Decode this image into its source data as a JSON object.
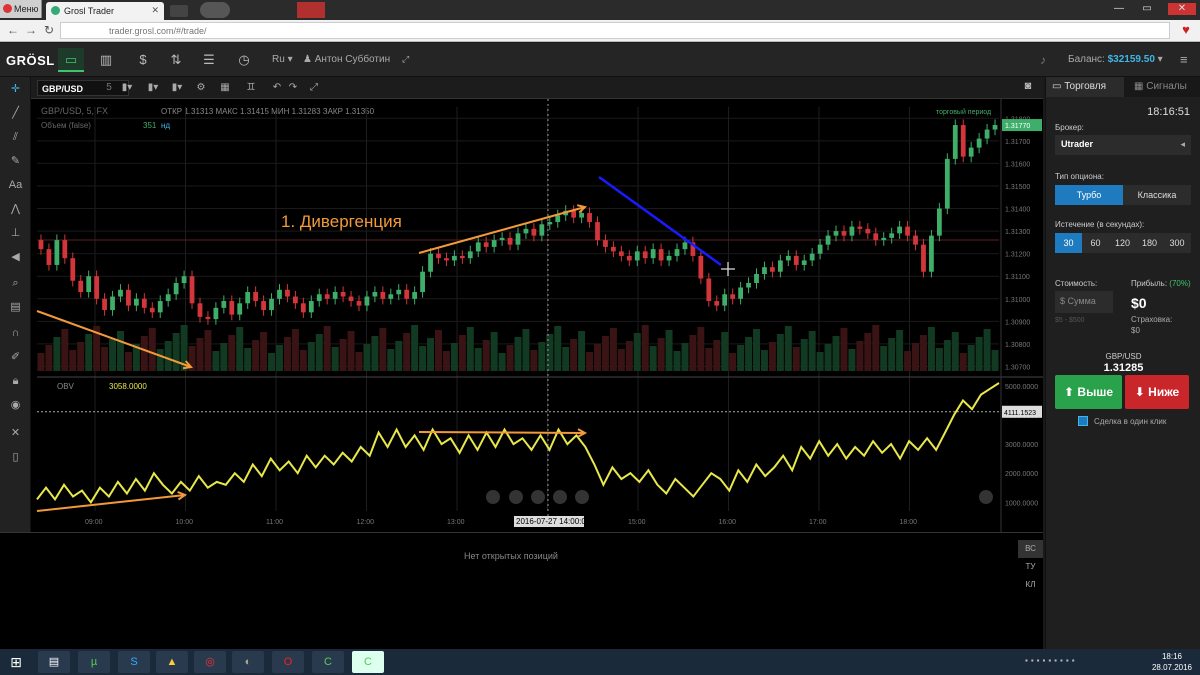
{
  "browser": {
    "menu_tab": "Меню",
    "tab_title": "Grosl Trader",
    "url": "trader.grosl.com/#/trade/"
  },
  "header": {
    "logo": "GRÖSL",
    "lang": "Ru",
    "user": "Антон Субботин",
    "balance_label": "Баланс:",
    "balance_value": "$32159.50"
  },
  "chart_toolbar": {
    "symbol": "GBP/USD",
    "timeframe": "5"
  },
  "chart_data": {
    "type": "candlestick",
    "title": "GBP/USD, 5, FX",
    "ohlc_labels": {
      "open": "ОТКР",
      "high": "МАКС",
      "low": "МИН",
      "close": "ЗАКР"
    },
    "ohlc_values": {
      "open": "1.31313",
      "high": "1.31415",
      "low": "1.31283",
      "close": "1.31350"
    },
    "volume_label": "Объем (false)",
    "volume_value": "351",
    "volume_unit": "нд",
    "session_label": "торговый период",
    "annotation": "1. Дивергенция",
    "price_axis": [
      "1.31800",
      "1.31700",
      "1.31600",
      "1.31500",
      "1.31400",
      "1.31300",
      "1.31200",
      "1.31100",
      "1.31000",
      "1.30900",
      "1.30800",
      "1.30700"
    ],
    "price_range": [
      1.3068,
      1.3185
    ],
    "current_price": "1.31770",
    "time_axis": [
      "09:00",
      "10:00",
      "11:00",
      "12:00",
      "13:00",
      "14:00",
      "15:00",
      "16:00",
      "17:00",
      "18:00"
    ],
    "crosshair_time": "2016-07-27 14:00:00",
    "close_series": [
      1.3122,
      1.3115,
      1.3126,
      1.3118,
      1.3108,
      1.3103,
      1.311,
      1.31,
      1.3095,
      1.3101,
      1.3104,
      1.3097,
      1.31,
      1.3096,
      1.3094,
      1.3099,
      1.3102,
      1.3107,
      1.311,
      1.3098,
      1.3092,
      1.3091,
      1.3096,
      1.3099,
      1.3093,
      1.3098,
      1.3103,
      1.3099,
      1.3095,
      1.31,
      1.3104,
      1.3101,
      1.3098,
      1.3094,
      1.3099,
      1.3102,
      1.31,
      1.3103,
      1.3101,
      1.3099,
      1.3097,
      1.3101,
      1.3103,
      1.31,
      1.3102,
      1.3104,
      1.31,
      1.3103,
      1.3112,
      1.312,
      1.3118,
      1.3117,
      1.3119,
      1.3118,
      1.3121,
      1.3125,
      1.3123,
      1.3126,
      1.3127,
      1.3124,
      1.3129,
      1.3131,
      1.3128,
      1.3133,
      1.3134,
      1.3137,
      1.3139,
      1.3136,
      1.3138,
      1.3134,
      1.3126,
      1.3123,
      1.3121,
      1.3119,
      1.3117,
      1.3121,
      1.3118,
      1.3122,
      1.3117,
      1.3119,
      1.3122,
      1.3125,
      1.3119,
      1.3109,
      1.3099,
      1.3097,
      1.3102,
      1.31,
      1.3105,
      1.3107,
      1.3111,
      1.3114,
      1.3112,
      1.3117,
      1.3119,
      1.3115,
      1.3117,
      1.312,
      1.3124,
      1.3128,
      1.313,
      1.3128,
      1.3132,
      1.3131,
      1.3129,
      1.3126,
      1.3127,
      1.3129,
      1.3132,
      1.3128,
      1.3124,
      1.3112,
      1.3128,
      1.314,
      1.3162,
      1.3177,
      1.3163,
      1.3167,
      1.3171,
      1.3175,
      1.3177
    ],
    "obv_label": "OBV",
    "obv_value": "3058.0000",
    "obv_marker": "4111.1523",
    "obv_axis": [
      "5000.0000",
      "4000.0000",
      "3000.0000",
      "2000.0000",
      "1000.0000"
    ],
    "obv_range": [
      700,
      5100
    ],
    "obv_series": [
      1100,
      1500,
      1100,
      1600,
      1200,
      1400,
      1000,
      1500,
      1200,
      1700,
      1300,
      1800,
      1400,
      2000,
      1600,
      1300,
      1700,
      1400,
      1900,
      1500,
      1700,
      1600,
      2000,
      1700,
      2300,
      1900,
      2500,
      2100,
      2400,
      2000,
      2600,
      2200,
      2600,
      2300,
      2700,
      2400,
      2900,
      2600,
      3400,
      2900,
      3500,
      2900,
      3300,
      2800,
      3500,
      3000,
      3200,
      2700,
      3300,
      2800,
      3400,
      2900,
      3500,
      3000,
      3200,
      2800,
      3300,
      2800,
      3500,
      3000,
      3300,
      2900,
      2300,
      1600,
      2200,
      1800,
      2000,
      1700,
      2100,
      1600,
      1300,
      1800,
      1500,
      1200,
      1600,
      2000,
      1800,
      1400,
      2100,
      1700,
      2300,
      1900,
      2200,
      2600,
      2100,
      2900,
      2500,
      3100,
      2600,
      3000,
      2500,
      2900,
      2600,
      3100,
      2700,
      3000,
      2500,
      3100,
      2800,
      3200,
      2800,
      3400,
      4000,
      4500,
      4200,
      4700,
      4900,
      5100
    ],
    "pattern_lines": [
      {
        "label": "price-support",
        "color": "#f29a3a"
      },
      {
        "label": "price-resistance",
        "color": "#f29a3a"
      },
      {
        "label": "obv-support",
        "color": "#f29a3a"
      },
      {
        "label": "obv-resistance",
        "color": "#f29a3a"
      },
      {
        "label": "price-trend-down",
        "color": "#1a1aff"
      }
    ]
  },
  "bottom": {
    "no_positions": "Нет открытых позиций",
    "tabs": [
      "ВС",
      "ТУ",
      "КЛ"
    ]
  },
  "panel": {
    "tab_trade": "Торговля",
    "tab_signals": "Сигналы",
    "clock": "18:16:51",
    "broker_label": "Брокер:",
    "broker_value": "Utrader",
    "option_type_label": "Тип опциона:",
    "option_types": [
      "Турбо",
      "Классика"
    ],
    "expiry_label": "Истечение (в секундах):",
    "expiry_values": [
      "30",
      "60",
      "120",
      "180",
      "300"
    ],
    "cost_label": "Стоимость:",
    "amount_placeholder": "$ Сумма",
    "range": "$5 - $500",
    "profit_label": "Прибыль:",
    "profit_pct": "(70%)",
    "profit_value": "$0",
    "insurance_label": "Страховка:",
    "insurance_value": "$0",
    "pair": "GBP/USD",
    "price": "1.31285",
    "up_label": "Выше",
    "down_label": "Ниже",
    "one_click": "Сделка в один клик"
  },
  "taskbar": {
    "time": "18:16",
    "date": "28.07.2016"
  },
  "colors": {
    "bull": "#3fae6a",
    "bear": "#d2363b",
    "obv": "#e8e84a",
    "accent": "#3fb6e6",
    "annotation": "#f29a3a"
  }
}
